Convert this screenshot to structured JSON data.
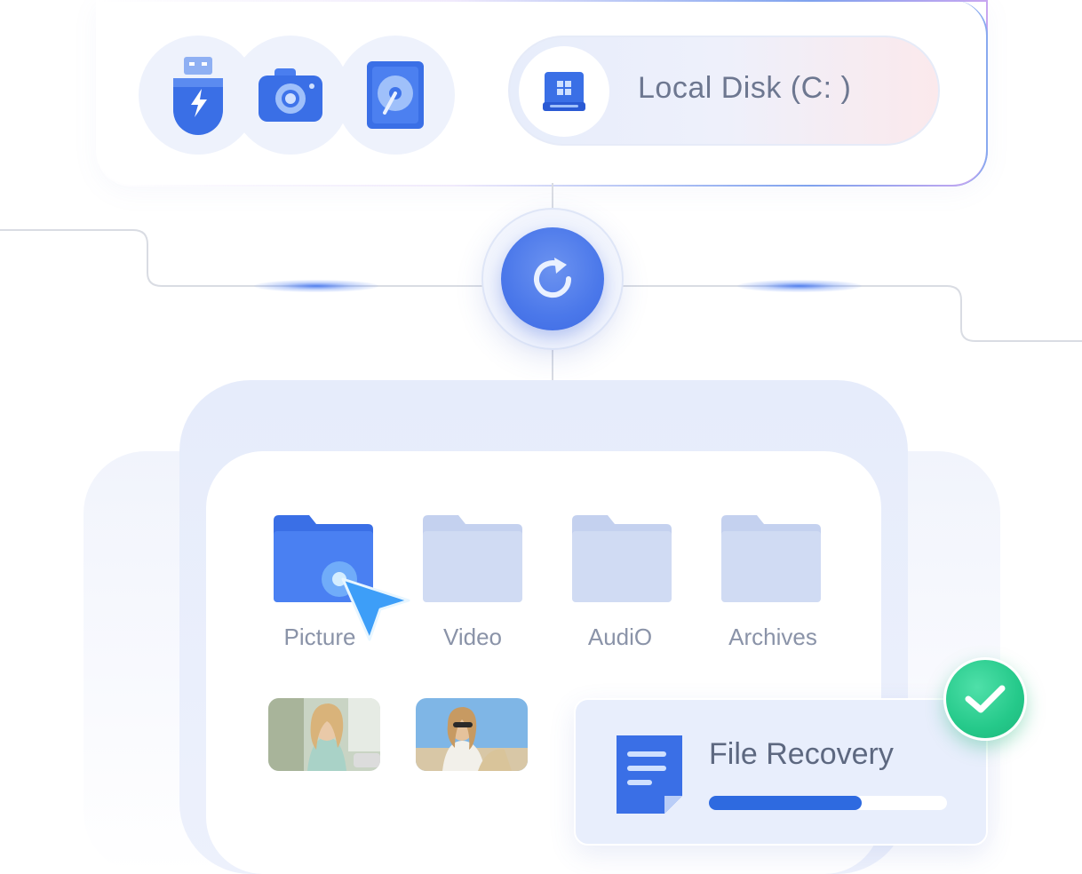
{
  "devices": {
    "icons": [
      "usb-drive-icon",
      "camera-icon",
      "hard-drive-icon"
    ],
    "selected_disk": {
      "icon": "windows-disk-icon",
      "label": "Local Disk (C: )"
    }
  },
  "action": {
    "icon": "refresh-icon"
  },
  "folders": [
    {
      "label": "Picture",
      "active": true
    },
    {
      "label": "Video",
      "active": false
    },
    {
      "label": "AudiO",
      "active": false
    },
    {
      "label": "Archives",
      "active": false
    }
  ],
  "thumbnails": [
    "photo-woman-street",
    "photo-woman-sunglasses"
  ],
  "recovery": {
    "icon": "document-icon",
    "title": "File Recovery",
    "progress": 0.64,
    "status_icon": "checkmark-icon"
  },
  "colors": {
    "accent": "#2e6ae0",
    "success": "#25c98a",
    "folder_active": "#3f74ea",
    "folder_inactive": "#cfd9f1"
  }
}
